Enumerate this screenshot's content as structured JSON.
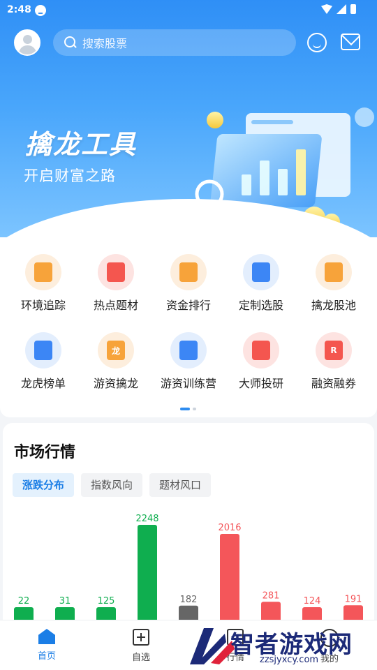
{
  "status_bar": {
    "time": "2:48"
  },
  "header": {
    "search_placeholder": "搜索股票"
  },
  "banner": {
    "title": "擒龙工具",
    "subtitle": "开启财富之路"
  },
  "features": [
    {
      "label": "环境追踪",
      "icon": "chart-doc-icon",
      "color": "#f7a33a",
      "bg": "#fdeedd"
    },
    {
      "label": "热点题材",
      "icon": "hot-icon",
      "color": "#f4564f",
      "bg": "#fde3e1"
    },
    {
      "label": "资金排行",
      "icon": "trend-shield-icon",
      "color": "#f7a33a",
      "bg": "#fdeedd"
    },
    {
      "label": "定制选股",
      "icon": "document-icon",
      "color": "#3c86f5",
      "bg": "#e3eefd"
    },
    {
      "label": "擒龙股池",
      "icon": "list-doc-icon",
      "color": "#f7a33a",
      "bg": "#fdeedd"
    },
    {
      "label": "龙虎榜单",
      "icon": "book-icon",
      "color": "#3c86f5",
      "bg": "#e3eefd"
    },
    {
      "label": "游资擒龙",
      "icon": "dragon-book-icon",
      "color": "#f7a33a",
      "bg": "#fdeedd",
      "glyph": "龙"
    },
    {
      "label": "游资训练营",
      "icon": "training-book-icon",
      "color": "#3c86f5",
      "bg": "#e3eefd"
    },
    {
      "label": "大师投研",
      "icon": "research-doc-icon",
      "color": "#f4564f",
      "bg": "#fde3e1"
    },
    {
      "label": "融资融券",
      "icon": "margin-ticket-icon",
      "color": "#f4564f",
      "bg": "#fde3e1",
      "glyph": "R"
    }
  ],
  "market": {
    "title": "市场行情",
    "tabs": [
      "涨跌分布",
      "指数风向",
      "题材风口"
    ],
    "active_tab": 0
  },
  "chart_data": {
    "type": "bar",
    "title": "",
    "values": [
      22,
      31,
      125,
      2248,
      182,
      2016,
      281,
      124,
      191
    ],
    "colors": [
      "#0fae4f",
      "#0fae4f",
      "#0fae4f",
      "#0fae4f",
      "#666666",
      "#f4565a",
      "#f4565a",
      "#f4565a",
      "#f4565a"
    ],
    "ylim": [
      0,
      2248
    ]
  },
  "bottom_nav": [
    {
      "label": "首页",
      "icon": "home-icon",
      "active": true
    },
    {
      "label": "自选",
      "icon": "watchlist-icon",
      "active": false
    },
    {
      "label": "行情",
      "icon": "market-icon",
      "active": false
    },
    {
      "label": "我的",
      "icon": "profile-icon",
      "active": false
    }
  ],
  "watermark": {
    "text": "智者游戏网",
    "sub": "zzsjyxcy.com"
  }
}
